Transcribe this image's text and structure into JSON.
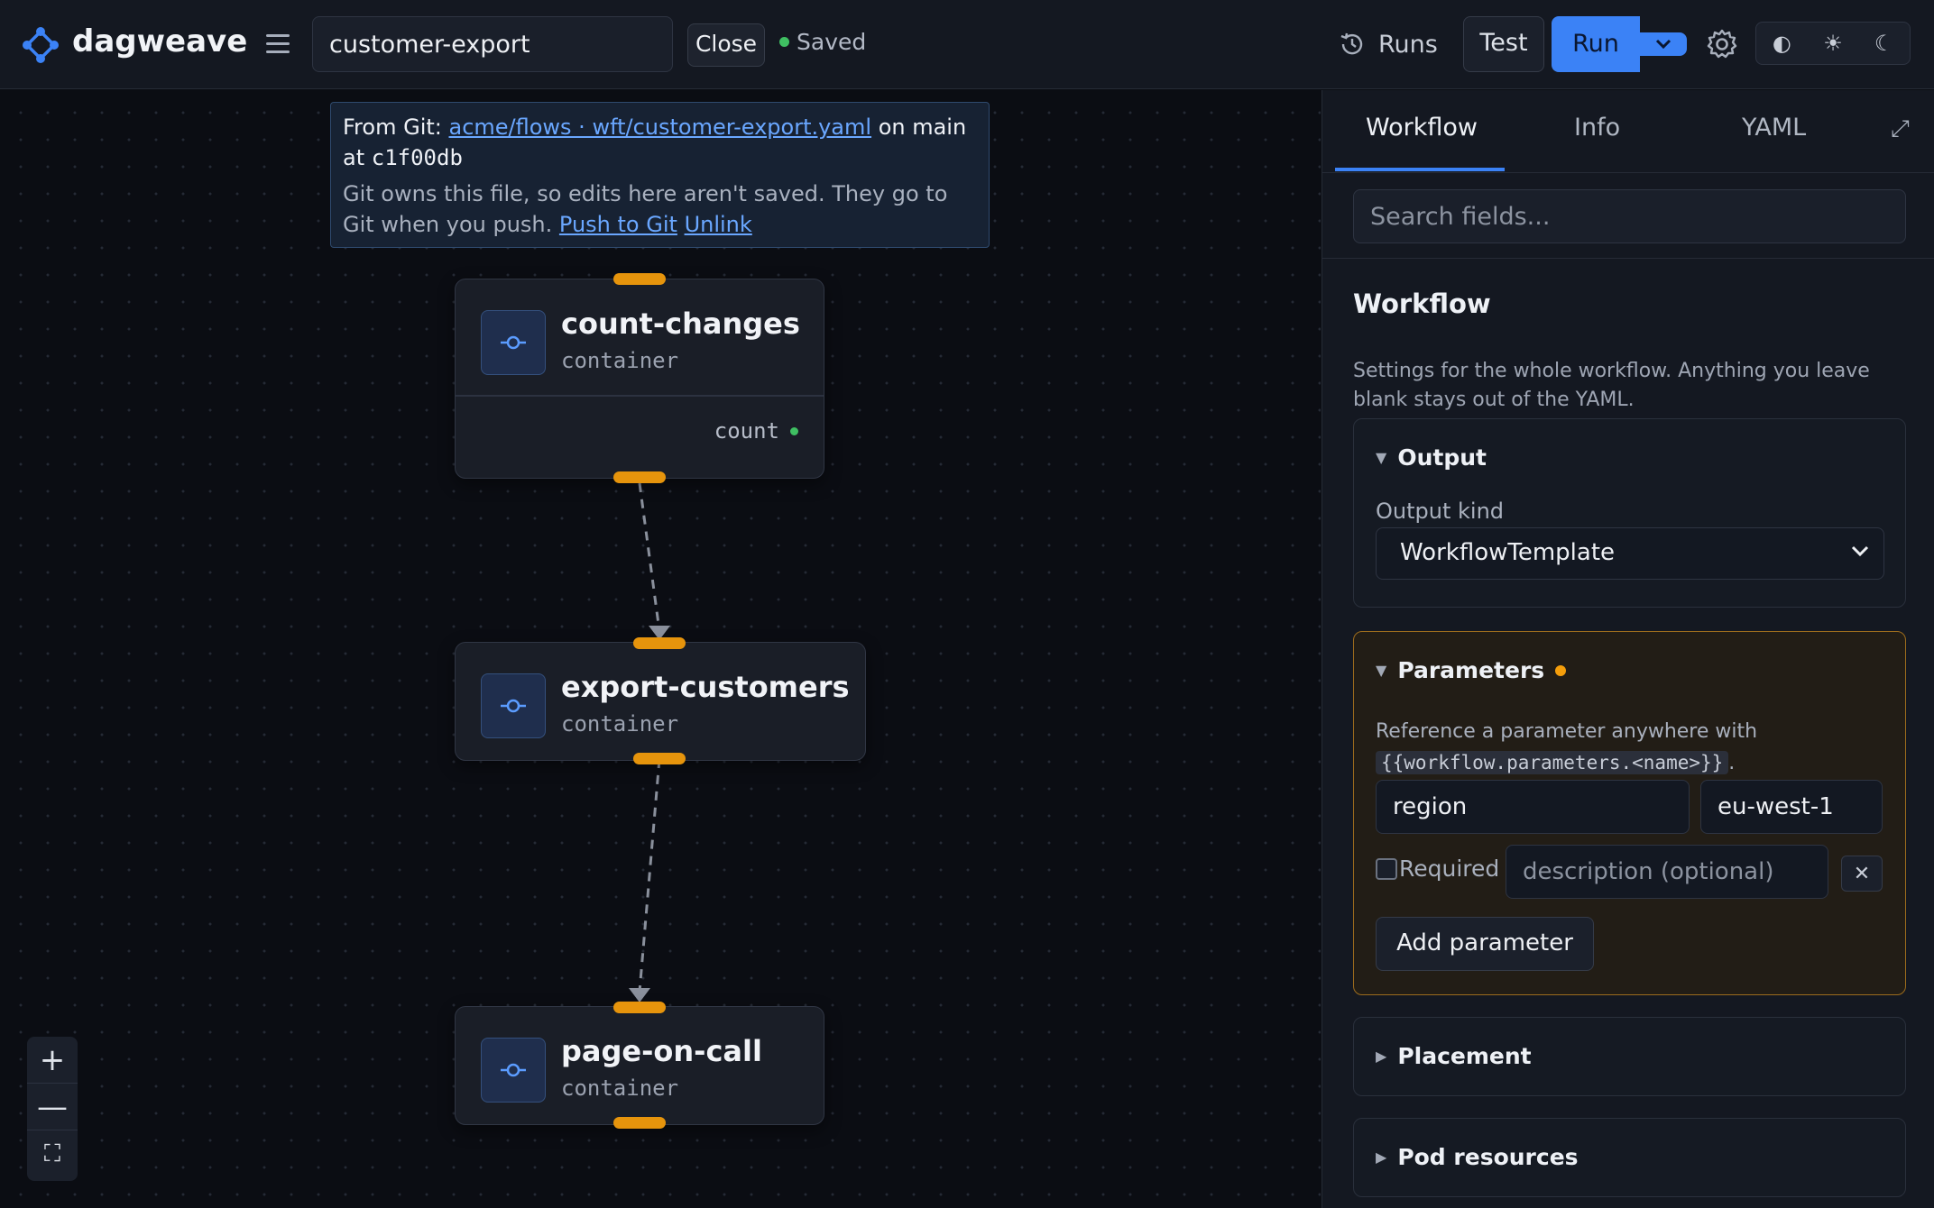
{
  "app": {
    "name": "dagweave"
  },
  "header": {
    "workflow_name": "customer-export",
    "close_label": "Close",
    "saved_label": "Saved",
    "runs_label": "Runs",
    "test_label": "Test",
    "run_label": "Run",
    "theme_options": [
      "◐",
      "☀",
      "☾"
    ]
  },
  "git_banner": {
    "prefix": "From Git: ",
    "repo_link": "acme/flows · wft/customer-export.yaml",
    "on_main": " on main",
    "at_label": "at ",
    "commit": "c1f00db",
    "note": "Git owns this file, so edits here aren't saved. They go to Git when you push. ",
    "push_link": "Push to Git",
    "unlink_link": "Unlink"
  },
  "nodes": [
    {
      "title": "count-changes",
      "type": "container",
      "output": "count"
    },
    {
      "title": "export-customers",
      "type": "container"
    },
    {
      "title": "page-on-call",
      "type": "container"
    }
  ],
  "zoom": {
    "in": "+",
    "out": "—",
    "fit": "⛶"
  },
  "panel": {
    "tabs": [
      "Workflow",
      "Info",
      "YAML"
    ],
    "expand_icon": "⤢",
    "search_placeholder": "Search fields...",
    "title": "Workflow",
    "description": "Settings for the whole workflow. Anything you leave blank stays out of the YAML.",
    "output": {
      "title": "Output",
      "field_label": "Output kind",
      "selected": "WorkflowTemplate"
    },
    "parameters": {
      "title": "Parameters",
      "help": "Reference a parameter anywhere with",
      "code": "{{workflow.parameters.<name>}}",
      "help_end": ".",
      "param_name": "region",
      "param_value": "eu-west-1",
      "required_label": "Required",
      "description_placeholder": "description (optional)",
      "remove_icon": "✕",
      "add_label": "Add parameter"
    },
    "placement": {
      "title": "Placement"
    },
    "pod_resources": {
      "title": "Pod resources"
    }
  },
  "colors": {
    "accent": "#3b82f6",
    "handle": "#e6940c",
    "saved": "#3fbf62",
    "modified": "#f59e0b"
  }
}
